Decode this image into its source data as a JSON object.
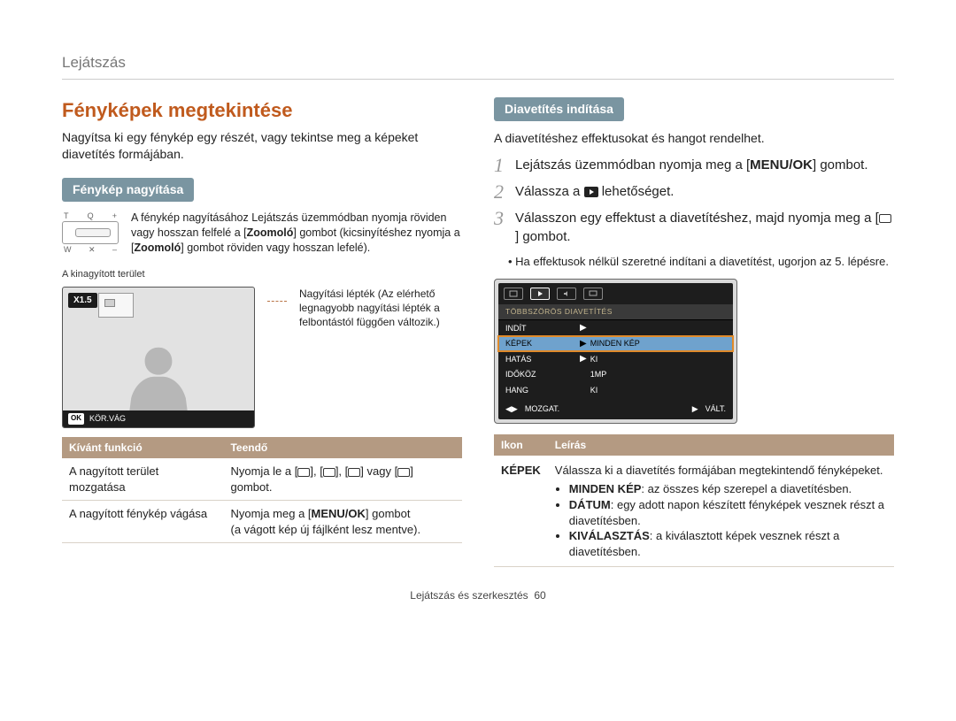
{
  "breadcrumb": "Lejátszás",
  "title": "Fényképek megtekintése",
  "intro": "Nagyítsa ki egy fénykép egy részét, vagy tekintse meg a képeket diavetítés formájában.",
  "left": {
    "subheading": "Fénykép nagyítása",
    "zoom_labels": {
      "t": "T",
      "q": "Q",
      "plus": "+",
      "w": "W",
      "x": "✕",
      "minus": "–"
    },
    "zoom_text_prefix": "A fénykép nagyításához Lejátszás üzemmódban nyomja röviden vagy hosszan felfelé a [",
    "zoom_bold1": "Zoomoló",
    "zoom_text_mid1": "] gombot (kicsinyítéshez nyomja a [",
    "zoom_bold2": "Zoomoló",
    "zoom_text_mid2": "] gombot röviden vagy hosszan lefelé).",
    "caption_top": "A kinagyított terület",
    "preview_badge": "X1.5",
    "preview_foot": "KÖR.VÁG",
    "annot_zoom": "Nagyítási lépték (Az elérhető legnagyobb nagyítási lépték a felbontástól függően változik.)",
    "func_table": {
      "headers": [
        "Kívánt funkció",
        "Teendő"
      ],
      "rows": [
        {
          "c0": "A nagyított terület mozgatása",
          "c1_prefix": "Nyomja le a [",
          "c1_suffix": "] gombot.",
          "c1_mid": " vagy "
        },
        {
          "c0": "A nagyított fénykép vágása",
          "c1_prefix": "Nyomja meg a [",
          "c1_bold": "MENU/OK",
          "c1_mid": "] gombot",
          "c1_note": "(a vágott kép új fájlként lesz mentve)."
        }
      ]
    }
  },
  "right": {
    "subheading": "Diavetítés indítása",
    "intro": "A diavetítéshez effektusokat és hangot rendelhet.",
    "steps": [
      {
        "num": "1",
        "prefix": "Lejátszás üzemmódban nyomja meg a [",
        "bold": "MENU/OK",
        "suffix": "] gombot."
      },
      {
        "num": "2",
        "prefix": "Válassza a ",
        "icon": true,
        "suffix": " lehetőséget."
      },
      {
        "num": "3",
        "prefix": "Válasszon egy effektust a diavetítéshez, majd nyomja meg a [",
        "icon_timer": true,
        "suffix": "] gombot."
      }
    ],
    "bullet": "Ha effektusok nélkül szeretné indítani a diavetítést, ugorjon az 5. lépésre.",
    "menu": {
      "title": "TÖBBSZÖRÖS DIAVETÍTÉS",
      "items": [
        {
          "left": "INDÍT",
          "right": "",
          "arrow": true
        },
        {
          "left": "KÉPEK",
          "right": "MINDEN KÉP",
          "arrow": true,
          "hi": true
        },
        {
          "left": "HATÁS",
          "right": "KI",
          "arrow": true
        },
        {
          "left": "IDŐKÖZ",
          "right": "1MP",
          "arrow": false
        },
        {
          "left": "HANG",
          "right": "KI",
          "arrow": false
        }
      ],
      "foot": {
        "move": "MOZGAT.",
        "change": "VÁLT."
      }
    },
    "desc_table": {
      "headers": [
        "Ikon",
        "Leírás"
      ],
      "row": {
        "icon": "KÉPEK",
        "lead": "Válassza ki a diavetítés formájában megtekintendő fényképeket.",
        "items": [
          {
            "bold": "MINDEN KÉP",
            "text": ": az összes kép szerepel a diavetítésben."
          },
          {
            "bold": "DÁTUM",
            "text": ": egy adott napon készített fényképek vesznek részt a diavetítésben."
          },
          {
            "bold": "KIVÁLASZTÁS",
            "text": ": a kiválasztott képek vesznek részt a diavetítésben."
          }
        ]
      }
    }
  },
  "footer": {
    "text": "Lejátszás és szerkesztés",
    "page": "60"
  }
}
